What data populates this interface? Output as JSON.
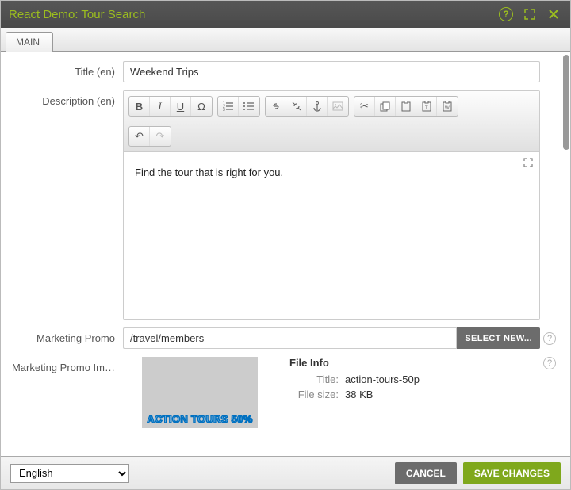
{
  "titlebar": {
    "title": "React Demo: Tour Search"
  },
  "tabs": {
    "main": "MAIN"
  },
  "fields": {
    "title_label": "Title (en)",
    "title_value": "Weekend Trips",
    "desc_label": "Description (en)",
    "desc_value": "Find the tour that is right for you.",
    "promo_label": "Marketing Promo",
    "promo_value": "/travel/members",
    "select_new": "SELECT NEW...",
    "promo_img_label": "Marketing Promo Im…"
  },
  "thumb": {
    "text": "ACTION TOURS 50%"
  },
  "fileinfo": {
    "heading": "File Info",
    "title_l": "Title:",
    "title_v": "action-tours-50p",
    "size_l": "File size:",
    "size_v": "38 KB"
  },
  "footer": {
    "language": "English",
    "cancel": "CANCEL",
    "save": "SAVE CHANGES"
  },
  "icons": {
    "bold": "B",
    "italic": "I",
    "underline": "U",
    "omega": "Ω",
    "ol": "≣",
    "ul": "≣",
    "link": "🔗",
    "anchor": "⚓",
    "cut": "✂",
    "copy": "⧉",
    "paste": "📋",
    "undo": "↶",
    "redo": "↷",
    "help": "?"
  }
}
